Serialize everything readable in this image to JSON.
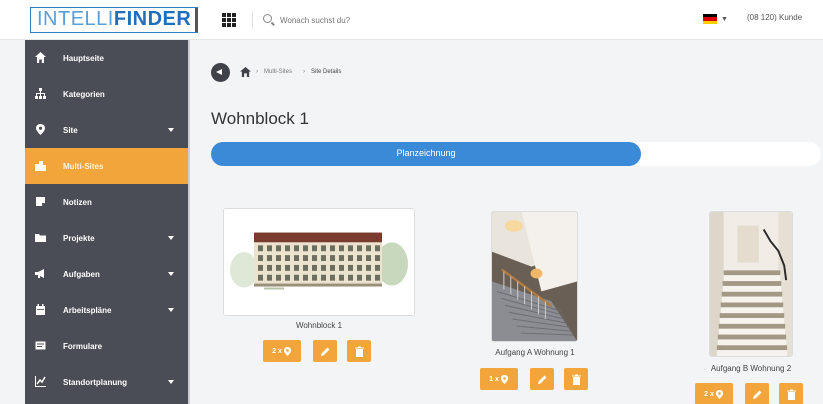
{
  "app": {
    "logo_part1": "INTELLI",
    "logo_part2": "FINDER"
  },
  "topbar": {
    "search_placeholder": "Wonach suchst du?",
    "language_flag": "flag-de-icon",
    "user_label": "(08 120) Kunde"
  },
  "colors": {
    "accent": "#f2a53a",
    "primary": "#3b8ad8",
    "sidebar_bg": "#4a4d55"
  },
  "sidebar": {
    "items": [
      {
        "label": "Hauptseite",
        "icon": "home-icon",
        "has_caret": false,
        "active": false
      },
      {
        "label": "Kategorien",
        "icon": "sitemap-icon",
        "has_caret": false,
        "active": false
      },
      {
        "label": "Site",
        "icon": "map-marker-icon",
        "has_caret": true,
        "active": false
      },
      {
        "label": "Multi-Sites",
        "icon": "buildings-icon",
        "has_caret": false,
        "active": true
      },
      {
        "label": "Notizen",
        "icon": "note-icon",
        "has_caret": false,
        "active": false
      },
      {
        "label": "Projekte",
        "icon": "folder-icon",
        "has_caret": true,
        "active": false
      },
      {
        "label": "Aufgaben",
        "icon": "bullhorn-icon",
        "has_caret": true,
        "active": false
      },
      {
        "label": "Arbeitspläne",
        "icon": "calendar-icon",
        "has_caret": true,
        "active": false
      },
      {
        "label": "Formulare",
        "icon": "form-icon",
        "has_caret": false,
        "active": false
      },
      {
        "label": "Standortplanung",
        "icon": "chart-icon",
        "has_caret": true,
        "active": false
      }
    ]
  },
  "breadcrumb": {
    "items": [
      "Multi-Sites",
      "Site Details"
    ]
  },
  "page": {
    "title": "Wohnblock 1"
  },
  "progress": {
    "label": "Planzeichnung",
    "fraction": 0.705
  },
  "cards": [
    {
      "title": "Wohnblock 1",
      "count": "2",
      "image": "building-facade"
    },
    {
      "title": "Aufgang A Wohnung 1",
      "count": "1",
      "image": "staircase-1"
    },
    {
      "title": "Aufgang B Wohnung 2",
      "count": "2",
      "image": "staircase-2"
    }
  ]
}
